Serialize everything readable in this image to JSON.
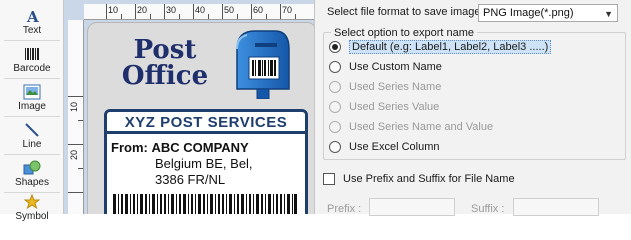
{
  "toolbox": {
    "items": [
      {
        "label": "Text",
        "icon": "text-icon"
      },
      {
        "label": "Barcode",
        "icon": "barcode-icon"
      },
      {
        "label": "Image",
        "icon": "image-icon"
      },
      {
        "label": "Line",
        "icon": "line-icon"
      },
      {
        "label": "Shapes",
        "icon": "shapes-icon"
      },
      {
        "label": "Symbol",
        "icon": "symbol-icon"
      }
    ]
  },
  "ruler": {
    "top_marks": [
      "10",
      "20",
      "30",
      "40",
      "50",
      "60",
      "70"
    ],
    "left_marks": [
      "10",
      "20"
    ]
  },
  "label_design": {
    "post_office_line1": "Post",
    "post_office_line2": "Office",
    "company_banner": "XYZ POST SERVICES",
    "from_prefix": "From:",
    "from_company": "ABC COMPANY",
    "address_line1": "Belgium BE, Bel,",
    "address_line2": "3386 FR/NL"
  },
  "export": {
    "format_label": "Select file format to save image :",
    "format_value": "PNG Image(*.png)",
    "group_title": "Select option to export name",
    "options": [
      {
        "label": "Default (e.g: Label1, Label2, Label3  .....)",
        "checked": true,
        "enabled": true
      },
      {
        "label": "Use Custom Name",
        "checked": false,
        "enabled": true
      },
      {
        "label": "Used Series Name",
        "checked": false,
        "enabled": false
      },
      {
        "label": "Used Series Value",
        "checked": false,
        "enabled": false
      },
      {
        "label": "Used Series Name and Value",
        "checked": false,
        "enabled": false
      },
      {
        "label": "Use Excel Column",
        "checked": false,
        "enabled": true
      }
    ],
    "prefix_suffix_checkbox": "Use Prefix and Suffix for File Name",
    "prefix_label": "Prefix :",
    "suffix_label": "Suffix :"
  },
  "colors": {
    "accent": "#1e3e6e",
    "mailbox_blue": "#1e6fc4",
    "canvas_bg": "#c9d7e8"
  }
}
